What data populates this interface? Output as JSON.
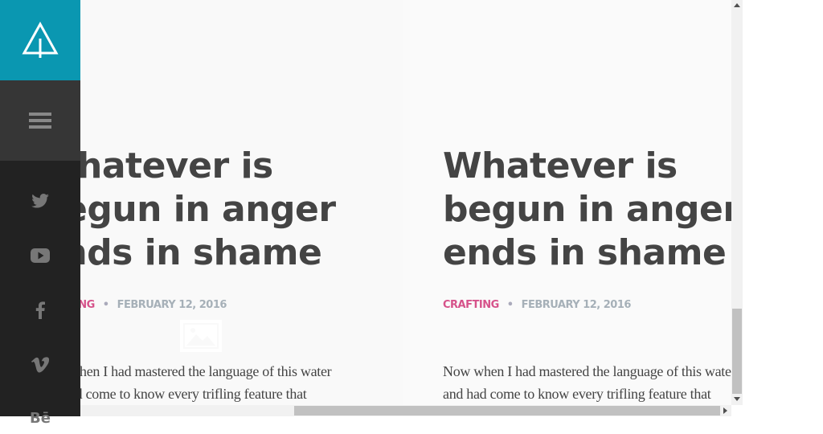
{
  "sidebar": {
    "brand_color": "#0a97b1",
    "logo_icon": "tree-logo-icon",
    "menu_icon": "hamburger-menu-icon",
    "social": [
      {
        "name": "twitter-icon",
        "glyph": "🐦"
      },
      {
        "name": "youtube-icon",
        "glyph": "▶"
      },
      {
        "name": "facebook-icon",
        "glyph": "f"
      },
      {
        "name": "vimeo-icon",
        "glyph": "v"
      },
      {
        "name": "behance-icon",
        "glyph": "Bē"
      }
    ]
  },
  "posts": [
    {
      "title_lines": [
        "Whatever is",
        "begun in anger",
        "ends in shame"
      ],
      "category": "CRAFTING",
      "separator": "•",
      "date": "FEBRUARY 12, 2016",
      "excerpt_lines": [
        "Now when I had mastered the language of this water",
        "and had come to know every trifling feature that"
      ]
    },
    {
      "title_lines": [
        "Whatever is",
        "begun in anger",
        "ends in shame"
      ],
      "category": "CRAFTING",
      "separator": "•",
      "date": "FEBRUARY 12, 2016",
      "excerpt_lines": [
        "Now when I had mastered the language of this water",
        "and had come to know every trifling feature that"
      ]
    }
  ],
  "colors": {
    "category": "#d6528a",
    "date": "#a6b0b8",
    "title": "#444444"
  }
}
